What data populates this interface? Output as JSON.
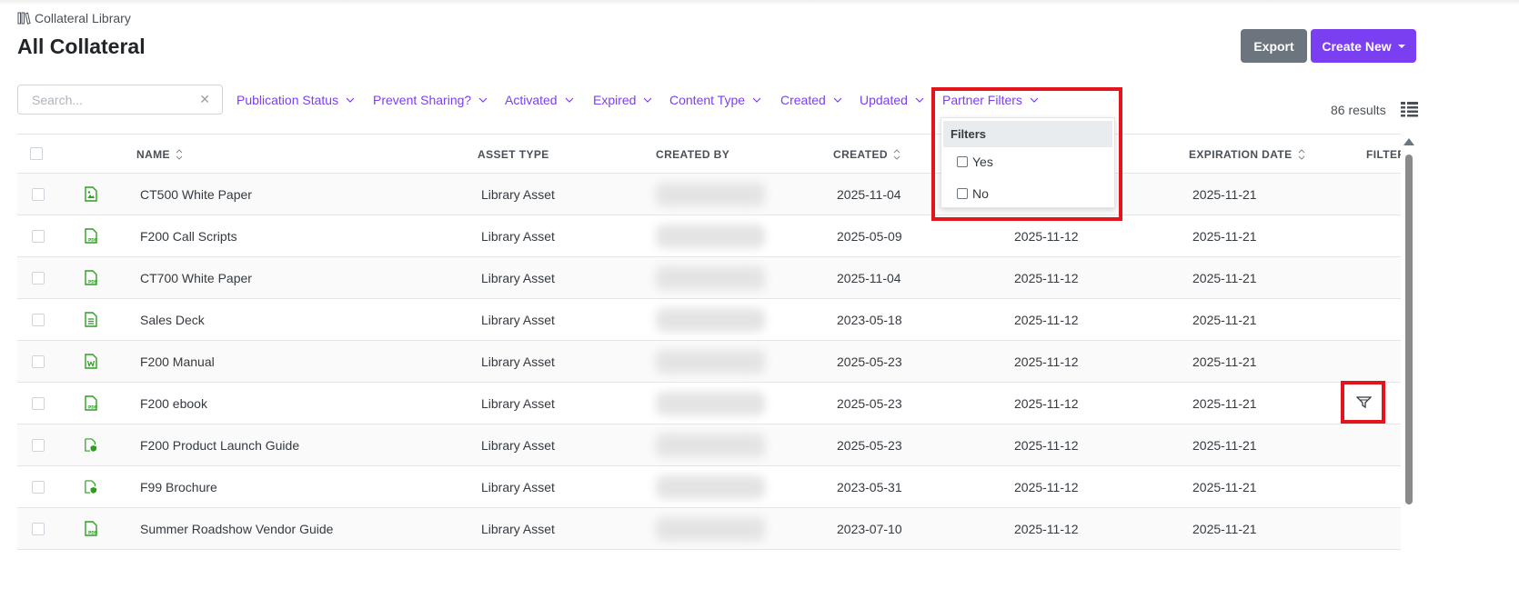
{
  "breadcrumb": {
    "label": "Collateral Library"
  },
  "header": {
    "title": "All Collateral",
    "export_label": "Export",
    "create_label": "Create New"
  },
  "search": {
    "placeholder": "Search...",
    "clear": "✕"
  },
  "filters": [
    {
      "label": "Publication Status"
    },
    {
      "label": "Prevent Sharing?"
    },
    {
      "label": "Activated"
    },
    {
      "label": "Expired"
    },
    {
      "label": "Content Type"
    },
    {
      "label": "Created"
    },
    {
      "label": "Updated"
    },
    {
      "label": "Partner Filters"
    }
  ],
  "results": {
    "label": "86 results"
  },
  "table": {
    "columns": {
      "name": "NAME",
      "asset_type": "ASSET TYPE",
      "created_by": "CREATED BY",
      "created": "CREATED",
      "expiration": "EXPIRATION DATE",
      "filter": "FILTER"
    },
    "rows": [
      {
        "icon": "image-file-icon",
        "name": "CT500 White Paper",
        "asset_type": "Library Asset",
        "created": "2025-11-04",
        "updated": "",
        "expiration": "2025-11-21"
      },
      {
        "icon": "pdf-file-icon",
        "name": "F200 Call Scripts",
        "asset_type": "Library Asset",
        "created": "2025-05-09",
        "updated": "2025-11-12",
        "expiration": "2025-11-21"
      },
      {
        "icon": "pdf-file-icon",
        "name": "CT700 White Paper",
        "asset_type": "Library Asset",
        "created": "2025-11-04",
        "updated": "2025-11-12",
        "expiration": "2025-11-21"
      },
      {
        "icon": "document-file-icon",
        "name": "Sales Deck",
        "asset_type": "Library Asset",
        "created": "2023-05-18",
        "updated": "2025-11-12",
        "expiration": "2025-11-21"
      },
      {
        "icon": "word-file-icon",
        "name": "F200 Manual",
        "asset_type": "Library Asset",
        "created": "2025-05-23",
        "updated": "2025-11-12",
        "expiration": "2025-11-21"
      },
      {
        "icon": "pdf-file-icon",
        "name": "F200 ebook",
        "asset_type": "Library Asset",
        "created": "2025-05-23",
        "updated": "2025-11-12",
        "expiration": "2025-11-21"
      },
      {
        "icon": "shield-file-icon",
        "name": "F200 Product Launch Guide",
        "asset_type": "Library Asset",
        "created": "2025-05-23",
        "updated": "2025-11-12",
        "expiration": "2025-11-21"
      },
      {
        "icon": "shield-file-icon",
        "name": "F99 Brochure",
        "asset_type": "Library Asset",
        "created": "2023-05-31",
        "updated": "2025-11-12",
        "expiration": "2025-11-21"
      },
      {
        "icon": "pdf-file-icon",
        "name": "Summer Roadshow Vendor Guide",
        "asset_type": "Library Asset",
        "created": "2023-07-10",
        "updated": "2025-11-12",
        "expiration": "2025-11-21"
      }
    ]
  },
  "partner_dropdown": {
    "header": "Filters",
    "options": [
      {
        "label": "Yes"
      },
      {
        "label": "No"
      }
    ]
  },
  "colors": {
    "accent": "#7b3ff2",
    "highlight": "#e3141c",
    "file_icon": "#2e9e22"
  }
}
